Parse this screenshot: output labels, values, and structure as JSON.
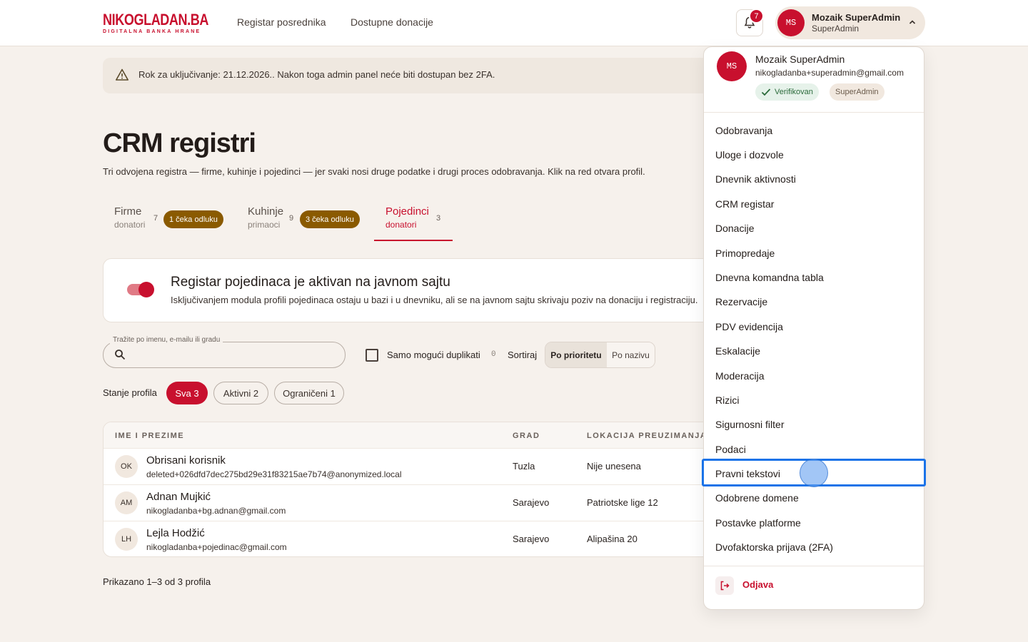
{
  "header": {
    "logo_main": "NIKOGLADAN.BA",
    "logo_sub": "DIGITALNA BANKA HRANE",
    "nav": [
      "Registar posrednika",
      "Dostupne donacije"
    ],
    "notifications_count": "7",
    "user_initials": "MS",
    "user_name": "Mozaik SuperAdmin",
    "user_role": "SuperAdmin"
  },
  "alert": {
    "text": "Rok za uključivanje: 21.12.2026.. Nakon toga admin panel neće biti dostupan bez 2FA."
  },
  "page": {
    "title": "CRM registri",
    "subtitle": "Tri odvojena registra — firme, kuhinje i pojedinci — jer svaki nosi druge podatke i drugi proces odobravanja. Klik na red otvara profil."
  },
  "tabs": [
    {
      "title": "Firme",
      "sub": "donatori",
      "count": "7",
      "pill": "1 čeka odluku"
    },
    {
      "title": "Kuhinje",
      "sub": "primaoci",
      "count": "9",
      "pill": "3 čeka odluku"
    },
    {
      "title": "Pojedinci",
      "sub": "donatori",
      "count": "3",
      "pill": ""
    }
  ],
  "module": {
    "title": "Registar pojedinaca je aktivan na javnom sajtu",
    "desc": "Isključivanjem modula profili pojedinaca ostaju u bazi i u dnevniku, ali se na javnom sajtu skrivaju poziv na donaciju i registraciju.",
    "enabled": true
  },
  "search": {
    "label": "Tražite po imenu, e-mailu ili gradu",
    "value": ""
  },
  "duplicates": {
    "label": "Samo mogući duplikati",
    "count": "0",
    "checked": false
  },
  "sort": {
    "label": "Sortiraj",
    "options": [
      "Po prioritetu",
      "Po nazivu"
    ],
    "selected": "Po prioritetu"
  },
  "filters": {
    "label": "Stanje profila",
    "chips": [
      "Sva 3",
      "Aktivni 2",
      "Ograničeni 1"
    ],
    "selected": "Sva 3"
  },
  "table": {
    "columns": [
      "IME I PREZIME",
      "GRAD",
      "LOKACIJA PREUZIMANJA"
    ],
    "rows": [
      {
        "initials": "OK",
        "name": "Obrisani korisnik",
        "email": "deleted+026dfd7dec275bd29e31f83215ae7b74@anonymized.local",
        "city": "Tuzla",
        "location": "Nije unesena"
      },
      {
        "initials": "AM",
        "name": "Adnan Mujkić",
        "email": "nikogladanba+bg.adnan@gmail.com",
        "city": "Sarajevo",
        "location": "Patriotske lige 12"
      },
      {
        "initials": "LH",
        "name": "Lejla Hodžić",
        "email": "nikogladanba+pojedinac@gmail.com",
        "city": "Sarajevo",
        "location": "Alipašina 20"
      }
    ]
  },
  "footer_text": "Prikazano 1–3 od 3 profila",
  "dropdown": {
    "name": "Mozaik SuperAdmin",
    "email": "nikogladanba+superadmin@gmail.com",
    "badge_verified": "Verifikovan",
    "badge_role": "SuperAdmin",
    "items": [
      "Odobravanja",
      "Uloge i dozvole",
      "Dnevnik aktivnosti",
      "CRM registar",
      "Donacije",
      "Primopredaje",
      "Dnevna komandna tabla",
      "Rezervacije",
      "PDV evidencija",
      "Eskalacije",
      "Moderacija",
      "Rizici",
      "Sigurnosni filter",
      "Podaci",
      "Pravni tekstovi",
      "Odobrene domene",
      "Postavke platforme",
      "Dvofaktorska prijava (2FA)"
    ],
    "highlighted": "Pravni tekstovi",
    "logout": "Odjava"
  },
  "colors": {
    "brand": "#c8102e",
    "pending": "#8a5a00",
    "background": "#f6f1ec",
    "focus": "#1a73e8"
  }
}
